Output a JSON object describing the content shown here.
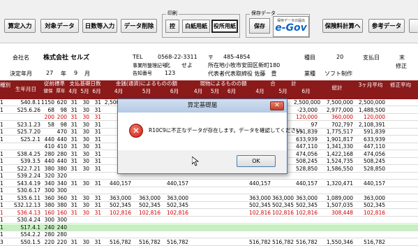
{
  "toolbar": {
    "buttons": [
      "算定入力",
      "対象データ",
      "日数等入力",
      "データ削除"
    ],
    "print_group": {
      "title": "印刷",
      "buttons": [
        "控",
        "白紙用紙",
        "役所用紙"
      ]
    },
    "save_group": {
      "title": "保存データ",
      "save_label": "保存",
      "egov_small": "保存データの提出",
      "egov_logo": "e-Gov"
    },
    "right_buttons": [
      "保険料計算へ",
      "参考データ"
    ]
  },
  "info": {
    "company_label": "会社名",
    "company_name": "株式会社 セルズ",
    "tel_label": "TEL",
    "tel_value": "0568-22-3311",
    "zip_mark": "〒",
    "zip_value": "485-4854",
    "seq_label": "事業所整理記号",
    "seq_value": "北　　せよ",
    "address_label": "所在地",
    "address_value": "小牧市安田区新町180",
    "num_label": "告知番号",
    "num_value": "123",
    "rep_label": "代表者",
    "rep_value": "代表取締役 佐藤　豊",
    "year_label": "決定年月",
    "year_value": "27",
    "year_unit": "年",
    "month_value": "9",
    "month_unit": "月",
    "branch_label": "種目",
    "branch_value": "20",
    "pay_label": "支払日",
    "pay_value": "末",
    "biz_label": "業種",
    "biz_value": "ソフト制作",
    "right_label": "修正"
  },
  "table_header": {
    "kind": "種別",
    "birth": "生年月日",
    "prev_std": "従前標準",
    "health": "健保",
    "pension": "厚年",
    "days": "支払基礎日数",
    "cash": "金銭(通貨)によるものの額",
    "goods": "現物によるものの額",
    "sum": "合　　　計",
    "total": "総計",
    "avg3": "3ヶ月平均",
    "fix_avg": "修正平均",
    "m4": "4月",
    "m5": "5月",
    "m6": "6月"
  },
  "rows": [
    {
      "k": "1",
      "b": "S40.8.1",
      "h": "1150",
      "p": "620",
      "d": [
        "31",
        "30",
        "31"
      ],
      "c": [
        "2,500,000",
        "",
        ""
      ],
      "g": [
        "",
        "",
        ""
      ],
      "s": [
        "",
        "",
        "2,500,000"
      ],
      "t": "7,500,000",
      "a": "2,500,000",
      "red": false
    },
    {
      "k": "1",
      "b": "S25.6.26",
      "h": "68",
      "p": "98",
      "d": [
        "31",
        "30",
        "31"
      ],
      "c": [
        "1,50",
        "",
        ""
      ],
      "g": [
        "",
        "",
        ""
      ],
      "s": [
        "",
        "",
        "-23,000"
      ],
      "t": "2,977,000",
      "a": "1,488,500",
      "red": false
    },
    {
      "k": "",
      "b": "",
      "h": "200",
      "p": "200",
      "d": [
        "31",
        "30",
        "31"
      ],
      "c": [
        "",
        "",
        ""
      ],
      "g": [
        "",
        "",
        ""
      ],
      "s": [
        "",
        "",
        "120,000"
      ],
      "t": "360,000",
      "a": "120,000",
      "red": true
    },
    {
      "k": "1",
      "b": "S23.1.23",
      "h": "58",
      "p": "98",
      "d": [
        "31",
        "30",
        "31"
      ],
      "c": [
        "",
        "",
        ""
      ],
      "g": [
        "",
        "",
        ""
      ],
      "s": [
        "",
        "",
        "97"
      ],
      "t": "702,797",
      "a": "2,108,391",
      "red": false
    },
    {
      "k": "1",
      "b": "S25.7.20",
      "h": "",
      "p": "470",
      "d": [
        "31",
        "30",
        "31"
      ],
      "c": [
        "591",
        "",
        ""
      ],
      "g": [
        "",
        "",
        ""
      ],
      "s": [
        "",
        "",
        "591,839"
      ],
      "t": "1,775,517",
      "a": "591,839",
      "red": false
    },
    {
      "k": "1",
      "b": "S25.2.1",
      "h": "440",
      "p": "440",
      "d": [
        "31",
        "30",
        "31"
      ],
      "c": [
        "633",
        "",
        ""
      ],
      "g": [
        "",
        "",
        ""
      ],
      "s": [
        "",
        "",
        "633,939"
      ],
      "t": "1,901,817",
      "a": "633,939",
      "red": false
    },
    {
      "k": "",
      "b": "",
      "h": "410",
      "p": "410",
      "d": [
        "31",
        "30",
        "31"
      ],
      "c": [
        "447",
        "",
        ""
      ],
      "g": [
        "",
        "",
        ""
      ],
      "s": [
        "",
        "",
        "447,110"
      ],
      "t": "1,341,330",
      "a": "447,110",
      "red": false
    },
    {
      "k": "1",
      "b": "S38.4.25",
      "h": "280",
      "p": "280",
      "d": [
        "31",
        "30",
        "31"
      ],
      "c": [
        "474",
        "",
        ""
      ],
      "g": [
        "",
        "",
        ""
      ],
      "s": [
        "",
        "",
        "474,056"
      ],
      "t": "1,422,168",
      "a": "474,056",
      "red": false
    },
    {
      "k": "1",
      "b": "S39.3.5",
      "h": "440",
      "p": "440",
      "d": [
        "31",
        "30",
        "31"
      ],
      "c": [
        "508",
        "",
        ""
      ],
      "g": [
        "",
        "",
        ""
      ],
      "s": [
        "",
        "",
        "508,245"
      ],
      "t": "1,524,735",
      "a": "508,245",
      "red": false
    },
    {
      "k": "1",
      "b": "S22.7.21",
      "h": "380",
      "p": "380",
      "d": [
        "31",
        "30",
        "31"
      ],
      "c": [
        "528",
        "",
        ""
      ],
      "g": [
        "",
        "",
        ""
      ],
      "s": [
        "",
        "",
        "528,850"
      ],
      "t": "1,586,550",
      "a": "528,850",
      "red": false
    },
    {
      "k": "1",
      "b": "S39.2.24",
      "h": "320",
      "p": "320",
      "d": [
        "",
        "",
        ""
      ],
      "c": [
        "",
        "",
        ""
      ],
      "g": [
        "",
        "",
        ""
      ],
      "s": [
        "",
        "",
        ""
      ],
      "t": "",
      "a": "",
      "red": false
    },
    {
      "k": "1",
      "b": "S43.4.19",
      "h": "340",
      "p": "340",
      "d": [
        "31",
        "30",
        "31"
      ],
      "c": [
        "440,157",
        "",
        "440,157"
      ],
      "g": [
        "",
        "",
        ""
      ],
      "s": [
        "440,157",
        "",
        "440,157"
      ],
      "t": "1,320,471",
      "a": "440,157",
      "red": false
    },
    {
      "k": "1",
      "b": "S30.6.17",
      "h": "300",
      "p": "300",
      "d": [
        "",
        "",
        ""
      ],
      "c": [
        "",
        "",
        ""
      ],
      "g": [
        "",
        "",
        ""
      ],
      "s": [
        "",
        "",
        ""
      ],
      "t": "",
      "a": "",
      "red": false
    },
    {
      "k": "1",
      "b": "S35.6.11",
      "h": "360",
      "p": "360",
      "d": [
        "31",
        "30",
        "31"
      ],
      "c": [
        "363,000",
        "363,000",
        "363,000"
      ],
      "g": [
        "",
        "",
        ""
      ],
      "s": [
        "363,000",
        "363,000",
        "363,000"
      ],
      "t": "1,089,000",
      "a": "363,000",
      "red": false
    },
    {
      "k": "1",
      "b": "S32.12.13",
      "h": "380",
      "p": "380",
      "d": [
        "31",
        "30",
        "31"
      ],
      "c": [
        "502,345",
        "502,345",
        "502,345"
      ],
      "g": [
        "",
        "",
        ""
      ],
      "s": [
        "502,345",
        "502,345",
        "502,345"
      ],
      "t": "1,507,035",
      "a": "502,345",
      "red": false
    },
    {
      "k": "1",
      "b": "S36.4.13",
      "h": "160",
      "p": "160",
      "d": [
        "31",
        "30",
        "31"
      ],
      "c": [
        "102,816",
        "102,816",
        "102,816"
      ],
      "g": [
        "",
        "",
        ""
      ],
      "s": [
        "102,816",
        "102,816",
        "102,816"
      ],
      "t": "308,448",
      "a": "102,816",
      "red": true
    },
    {
      "k": "1",
      "b": "S30.4.24",
      "h": "300",
      "p": "300",
      "d": [
        "",
        "",
        ""
      ],
      "c": [
        "",
        "",
        ""
      ],
      "g": [
        "",
        "",
        ""
      ],
      "s": [
        "",
        "",
        ""
      ],
      "t": "",
      "a": "",
      "red": false
    },
    {
      "k": "1",
      "b": "S17.4.1",
      "h": "240",
      "p": "240",
      "d": [
        "",
        "",
        ""
      ],
      "c": [
        "",
        "",
        ""
      ],
      "g": [
        "",
        "",
        ""
      ],
      "s": [
        "",
        "",
        ""
      ],
      "t": "",
      "a": "",
      "red": false,
      "green": true
    },
    {
      "k": "1",
      "b": "S54.2.2",
      "h": "280",
      "p": "280",
      "d": [
        "",
        "",
        ""
      ],
      "c": [
        "",
        "",
        ""
      ],
      "g": [
        "",
        "",
        ""
      ],
      "s": [
        "",
        "",
        ""
      ],
      "t": "",
      "a": "",
      "red": false
    },
    {
      "k": "3",
      "b": "S50.1.5",
      "h": "220",
      "p": "220",
      "d": [
        "31",
        "30",
        "31"
      ],
      "c": [
        "516,782",
        "516,782",
        "516,782"
      ],
      "g": [
        "",
        "",
        ""
      ],
      "s": [
        "516,782",
        "516,782",
        "516,782"
      ],
      "t": "1,550,346",
      "a": "516,782",
      "red": false
    }
  ],
  "dialog": {
    "title": "算定基礎届",
    "close": "✕",
    "message": "R10C9に不正なデータが存在します。データを確認してください。",
    "icon_glyph": "✕",
    "ok_label": "OK"
  }
}
